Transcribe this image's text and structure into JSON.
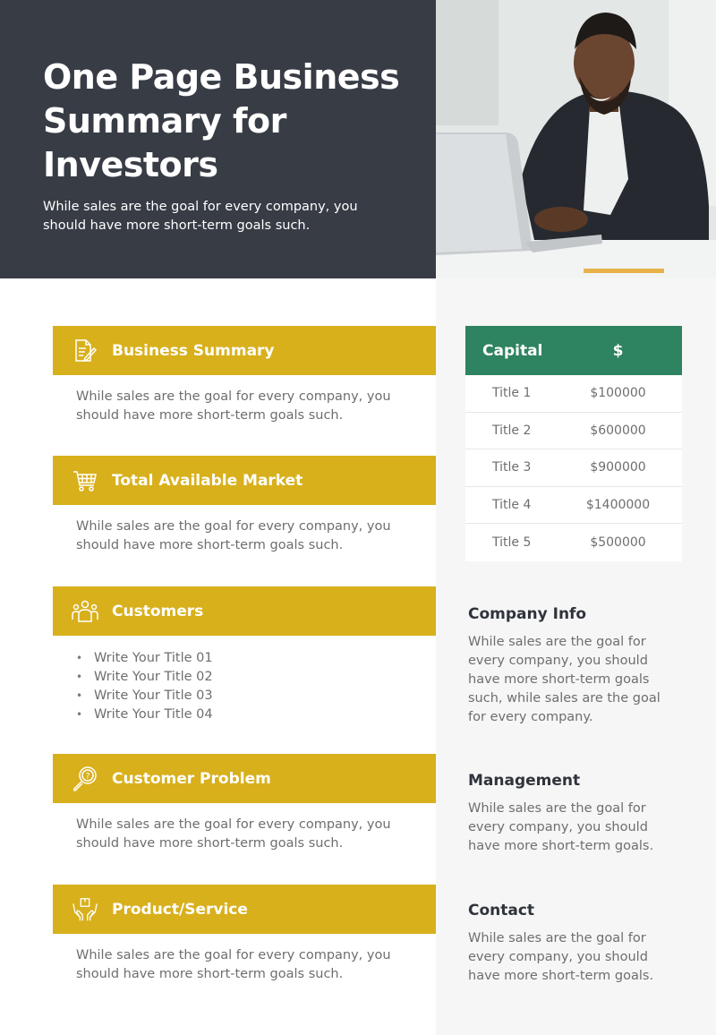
{
  "header": {
    "title": "One Page Business Summary for Investors",
    "subtitle": "While sales are the goal for every company, you should have more short-term goals such.",
    "photo": "man-smiling-at-laptop-photo"
  },
  "colors": {
    "header_bg": "#373c45",
    "section_bar": "#d8b01c",
    "table_header": "#2e8360",
    "right_panel_bg": "#f6f6f6",
    "body_text": "#6e6e6e",
    "heading_text": "#2f333b"
  },
  "sections": [
    {
      "icon": "document-edit-icon",
      "title": "Business Summary",
      "body": "While sales are the goal for every company, you should have more short-term goals such."
    },
    {
      "icon": "shopping-cart-icon",
      "title": "Total Available Market",
      "body": "While sales are the goal for every company, you should have more short-term goals such."
    },
    {
      "icon": "people-group-icon",
      "title": "Customers",
      "items": [
        "Write Your Title 01",
        "Write Your Title 02",
        "Write Your Title 03",
        "Write Your Title 04"
      ]
    },
    {
      "icon": "magnifier-question-icon",
      "title": "Customer Problem",
      "body": "While sales are the goal for every company, you should have more short-term goals such."
    },
    {
      "icon": "hands-box-icon",
      "title": "Product/Service",
      "body": "While sales are the goal for every company, you should have more short-term goals such."
    }
  ],
  "capital_table": {
    "headers": [
      "Capital",
      "$"
    ],
    "rows": [
      [
        "Title 1",
        "$100000"
      ],
      [
        "Title 2",
        "$600000"
      ],
      [
        "Title 3",
        "$900000"
      ],
      [
        "Title 4",
        "$1400000"
      ],
      [
        "Title 5",
        "$500000"
      ]
    ]
  },
  "info_blocks": [
    {
      "title": "Company Info",
      "body": "While sales are the goal for every company, you should have more short-term goals such, while sales are the goal for every company."
    },
    {
      "title": "Management",
      "body": "While sales are the goal for every company, you should have more short-term goals."
    },
    {
      "title": "Contact",
      "body": "While sales are the goal for every company, you should have more short-term goals."
    }
  ]
}
